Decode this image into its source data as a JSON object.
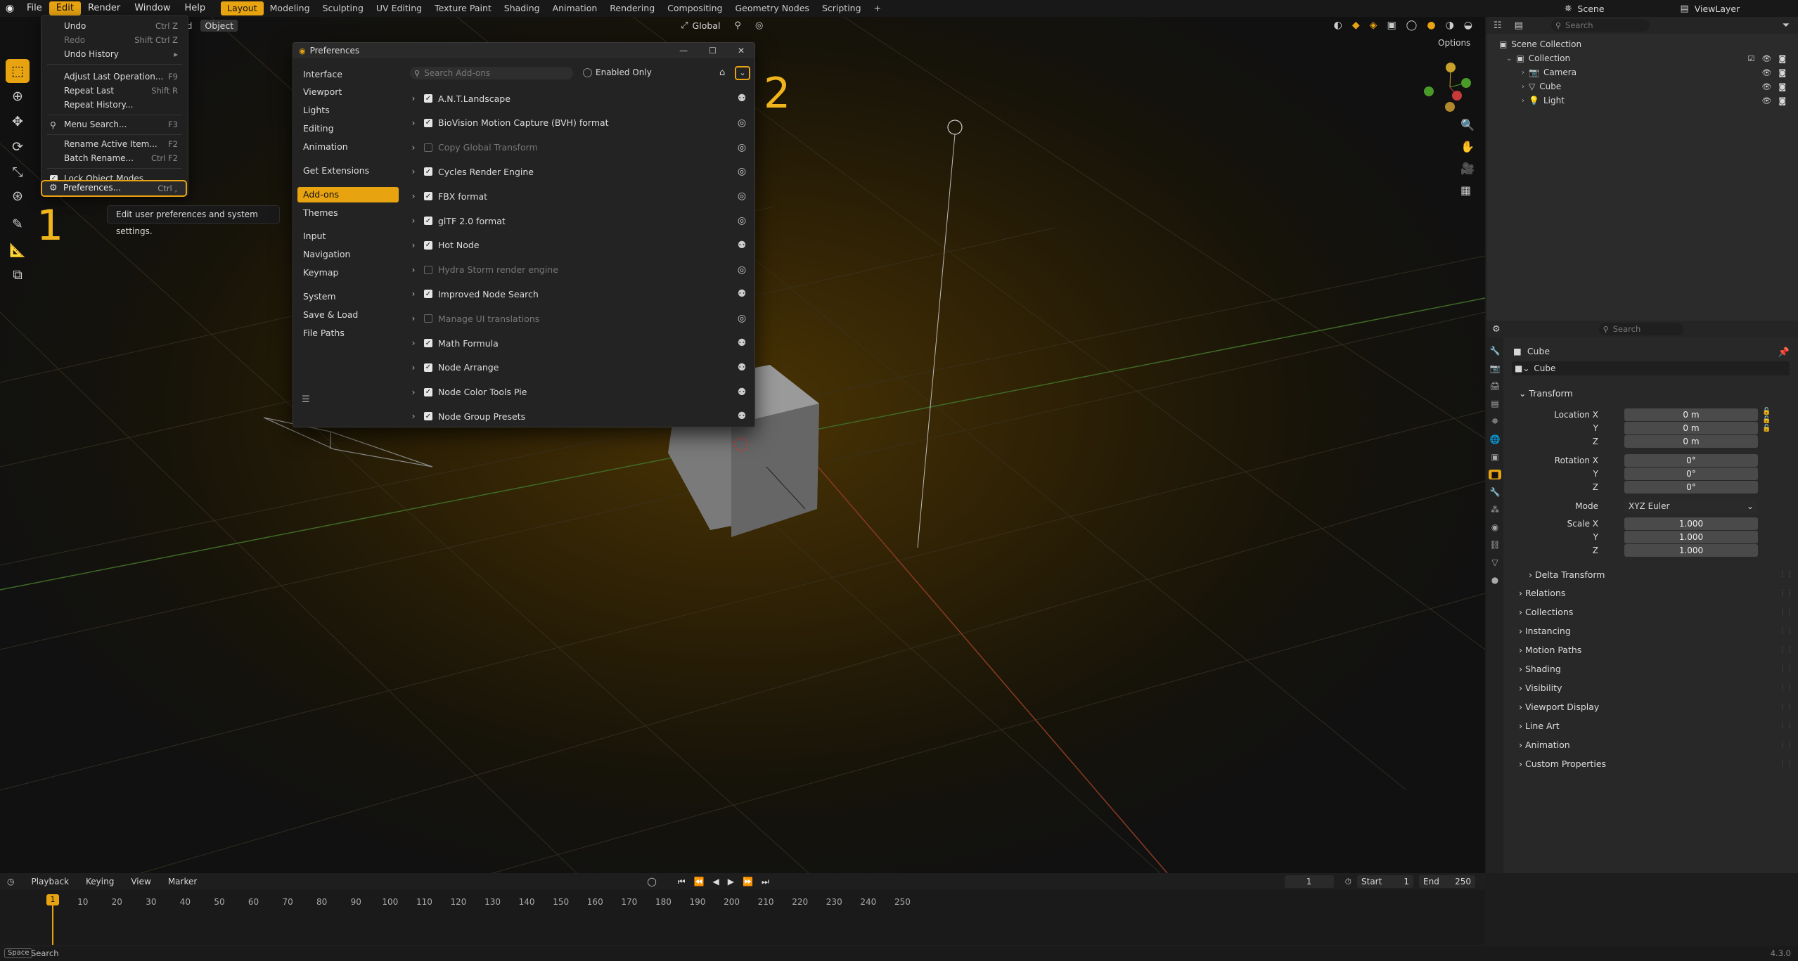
{
  "topbar": {
    "menus": [
      "File",
      "Edit",
      "Render",
      "Window",
      "Help"
    ],
    "workspaces": [
      "Layout",
      "Modeling",
      "Sculpting",
      "UV Editing",
      "Texture Paint",
      "Shading",
      "Animation",
      "Rendering",
      "Compositing",
      "Geometry Nodes",
      "Scripting"
    ],
    "scene": "Scene",
    "view_layer": "ViewLayer"
  },
  "viewport_header": {
    "mode_fragment": "id",
    "object_menu": "Object",
    "transform_orientation": "Global",
    "options": "Options"
  },
  "edit_menu": {
    "items": [
      {
        "label": "Undo",
        "shortcut": "Ctrl Z"
      },
      {
        "label": "Redo",
        "shortcut": "Shift Ctrl Z"
      },
      {
        "label": "Undo History",
        "shortcut": "▸"
      },
      {
        "label": "Adjust Last Operation...",
        "shortcut": "F9"
      },
      {
        "label": "Repeat Last",
        "shortcut": "Shift R"
      },
      {
        "label": "Repeat History...",
        "shortcut": ""
      },
      {
        "label": "Menu Search...",
        "shortcut": "F3"
      },
      {
        "label": "Rename Active Item...",
        "shortcut": "F2"
      },
      {
        "label": "Batch Rename...",
        "shortcut": "Ctrl F2"
      },
      {
        "label": "Lock Object Modes",
        "shortcut": ""
      },
      {
        "label": "Preferences...",
        "shortcut": "Ctrl ,"
      }
    ],
    "tooltip": "Edit user preferences and system settings."
  },
  "annotations": {
    "step1": "1",
    "step2": "2"
  },
  "preferences": {
    "title": "Preferences",
    "nav": [
      "Interface",
      "Viewport",
      "Lights",
      "Editing",
      "Animation",
      "Get Extensions",
      "Add-ons",
      "Themes",
      "Input",
      "Navigation",
      "Keymap",
      "System",
      "Save & Load",
      "File Paths"
    ],
    "search_placeholder": "Search Add-ons",
    "enabled_only": "Enabled Only",
    "addons": [
      {
        "name": "A.N.T.Landscape",
        "enabled": true
      },
      {
        "name": "BioVision Motion Capture (BVH) format",
        "enabled": true
      },
      {
        "name": "Copy Global Transform",
        "enabled": false
      },
      {
        "name": "Cycles Render Engine",
        "enabled": true
      },
      {
        "name": "FBX format",
        "enabled": true
      },
      {
        "name": "glTF 2.0 format",
        "enabled": true
      },
      {
        "name": "Hot Node",
        "enabled": true
      },
      {
        "name": "Hydra Storm render engine",
        "enabled": false
      },
      {
        "name": "Improved Node Search",
        "enabled": true
      },
      {
        "name": "Manage UI translations",
        "enabled": false
      },
      {
        "name": "Math Formula",
        "enabled": true
      },
      {
        "name": "Node Arrange",
        "enabled": true
      },
      {
        "name": "Node Color Tools Pie",
        "enabled": true
      },
      {
        "name": "Node Group Presets",
        "enabled": true
      }
    ]
  },
  "outliner": {
    "search_placeholder": "Search",
    "scene_collection": "Scene Collection",
    "collection": "Collection",
    "objects": [
      "Camera",
      "Cube",
      "Light"
    ]
  },
  "properties": {
    "search_placeholder": "Search",
    "object_name": "Cube",
    "data_name": "Cube",
    "transform": "Transform",
    "location_label": "Location X",
    "rotation_label": "Rotation X",
    "scale_label": "Scale X",
    "y_label": "Y",
    "z_label": "Z",
    "mode_label": "Mode",
    "location": [
      "0 m",
      "0 m",
      "0 m"
    ],
    "rotation": [
      "0°",
      "0°",
      "0°"
    ],
    "mode": "XYZ Euler",
    "scale": [
      "1.000",
      "1.000",
      "1.000"
    ],
    "panels": [
      "Delta Transform",
      "Relations",
      "Collections",
      "Instancing",
      "Motion Paths",
      "Shading",
      "Visibility",
      "Viewport Display",
      "Line Art",
      "Animation",
      "Custom Properties"
    ]
  },
  "timeline": {
    "menus": [
      "Playback",
      "Keying",
      "View",
      "Marker"
    ],
    "current_frame": "1",
    "start_label": "Start",
    "start": "1",
    "end_label": "End",
    "end": "250",
    "ticks": [
      "1",
      "10",
      "20",
      "30",
      "40",
      "50",
      "60",
      "70",
      "80",
      "90",
      "100",
      "110",
      "120",
      "130",
      "140",
      "150",
      "160",
      "170",
      "180",
      "190",
      "200",
      "210",
      "220",
      "230",
      "240",
      "250"
    ]
  },
  "statusbar": {
    "key": "Space",
    "action": "Search",
    "version": "4.3.0"
  }
}
